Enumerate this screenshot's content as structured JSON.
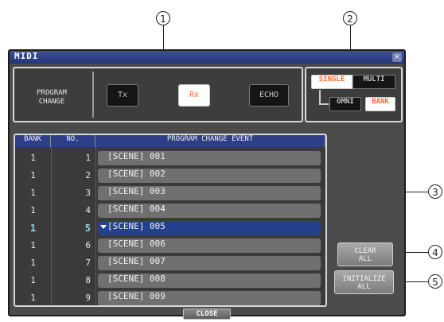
{
  "callouts": [
    "1",
    "2",
    "3",
    "4",
    "5"
  ],
  "window": {
    "title": "MIDI",
    "close_glyph": "×"
  },
  "program_change": {
    "label_line1": "PROGRAM",
    "label_line2": "CHANGE",
    "tx": "Tx",
    "rx": "Rx",
    "echo": "ECHO"
  },
  "mode": {
    "single": "SINGLE",
    "multi": "MULTI",
    "omni": "OMNI",
    "bank": "BANK",
    "active_color": "#ff6a2f"
  },
  "table": {
    "headers": {
      "bank": "BANK",
      "no": "NO.",
      "event": "PROGRAM CHANGE EVENT"
    },
    "rows": [
      {
        "bank": "1",
        "no": "1",
        "event": "[SCENE] 001"
      },
      {
        "bank": "1",
        "no": "2",
        "event": "[SCENE] 002"
      },
      {
        "bank": "1",
        "no": "3",
        "event": "[SCENE] 003"
      },
      {
        "bank": "1",
        "no": "4",
        "event": "[SCENE] 004"
      },
      {
        "bank": "1",
        "no": "5",
        "event": "[SCENE] 005",
        "selected": true
      },
      {
        "bank": "1",
        "no": "6",
        "event": "[SCENE] 006"
      },
      {
        "bank": "1",
        "no": "7",
        "event": "[SCENE] 007"
      },
      {
        "bank": "1",
        "no": "8",
        "event": "[SCENE] 008"
      },
      {
        "bank": "1",
        "no": "9",
        "event": "[SCENE] 009"
      }
    ]
  },
  "side_buttons": {
    "clear_line1": "CLEAR",
    "clear_line2": "ALL",
    "init_line1": "INITIALIZE",
    "init_line2": "ALL"
  },
  "footer": {
    "close": "CLOSE"
  }
}
